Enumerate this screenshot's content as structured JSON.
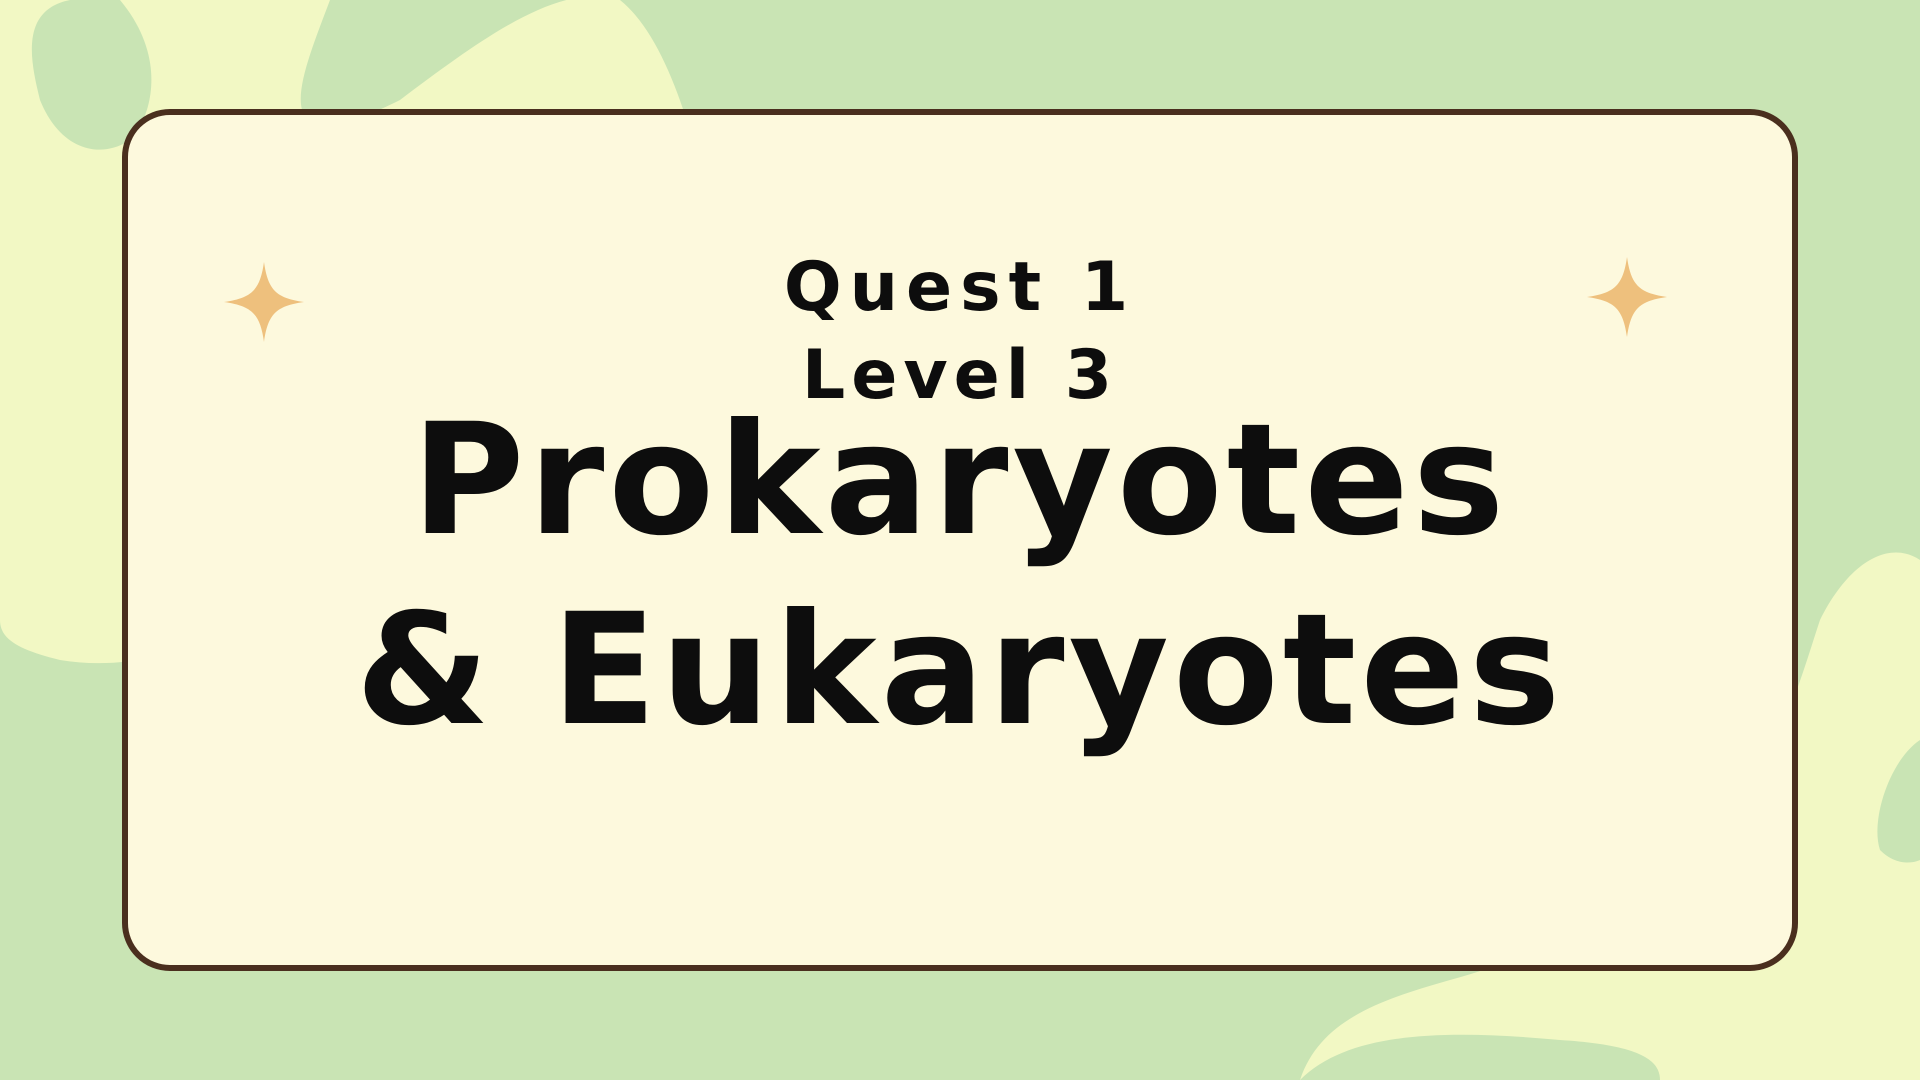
{
  "colors": {
    "background": "#c9e4b4",
    "blob": "#f2f8c4",
    "card_fill": "#fdf9dd",
    "card_border": "#4a2f1e",
    "sparkle": "#eec07d",
    "text": "#0d0d0d"
  },
  "slide": {
    "quest_label": "Quest 1",
    "level_label": "Level 3",
    "title_line1": "Prokaryotes",
    "title_line2": "& Eukaryotes"
  },
  "decorations": {
    "left_icon": "sparkle-icon",
    "right_icon": "sparkle-icon"
  }
}
